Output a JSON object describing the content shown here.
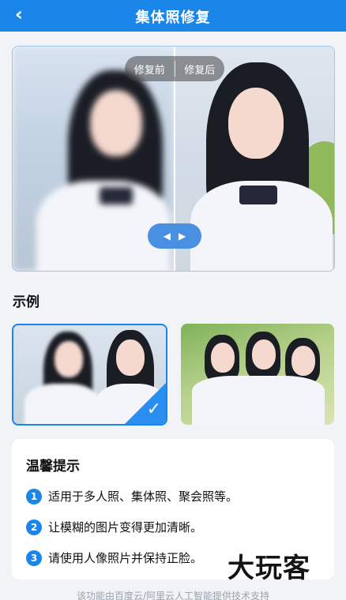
{
  "header": {
    "title": "集体照修复",
    "back_icon": "chevron-left-icon"
  },
  "compare": {
    "before_label": "修复前",
    "after_label": "修复后",
    "slider_left": "◀",
    "slider_right": "▶"
  },
  "examples": {
    "section_title": "示例",
    "selected_icon": "checkmark-icon"
  },
  "tips": {
    "title": "温馨提示",
    "items": [
      {
        "num": "1",
        "text": "适用于多人照、集体照、聚会照等。"
      },
      {
        "num": "2",
        "text": "让模糊的图片变得更加清晰。"
      },
      {
        "num": "3",
        "text": "请使用人像照片并保持正脸。"
      }
    ]
  },
  "watermark": "大玩客",
  "footer": "该功能由百度云/阿里云人工智能提供技术支持",
  "colors": {
    "accent": "#1a86ea",
    "background": "#f1f3f7"
  }
}
